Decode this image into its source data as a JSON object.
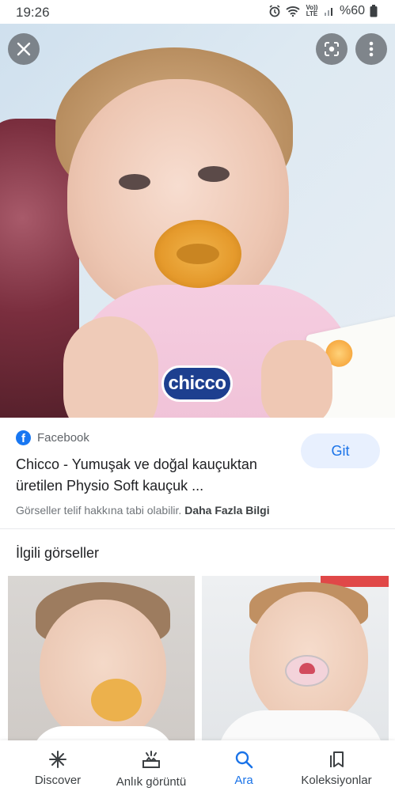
{
  "status_bar": {
    "time": "19:26",
    "network": "Vo)) LTE",
    "battery": "%60",
    "icons": [
      "alarm-icon",
      "wifi-icon",
      "volte-icon",
      "signal-icon",
      "battery-icon"
    ]
  },
  "viewer": {
    "image_logo_text": "chicco",
    "buttons": {
      "close_icon": "close-icon",
      "lens_icon": "lens-icon",
      "more_icon": "more-vert-icon"
    }
  },
  "result": {
    "source": "Facebook",
    "title": "Chicco - Yumuşak ve doğal kauçuktan üretilen Physio Soft kauçuk ...",
    "visit_label": "Git",
    "copyright_text": "Görseller telif hakkına tabi olabilir.",
    "more_info": "Daha Fazla Bilgi"
  },
  "related": {
    "title": "İlgili görseller"
  },
  "bottom_nav": {
    "items": [
      {
        "label": "Discover",
        "icon": "asterisk-icon"
      },
      {
        "label": "Anlık görüntü",
        "icon": "snapshot-icon"
      },
      {
        "label": "Ara",
        "icon": "search-icon",
        "active": true
      },
      {
        "label": "Koleksiyonlar",
        "icon": "collections-icon"
      }
    ]
  },
  "colors": {
    "accent": "#1a73e8",
    "facebook": "#1877f2",
    "chicco_blue": "#1d3f8f"
  }
}
